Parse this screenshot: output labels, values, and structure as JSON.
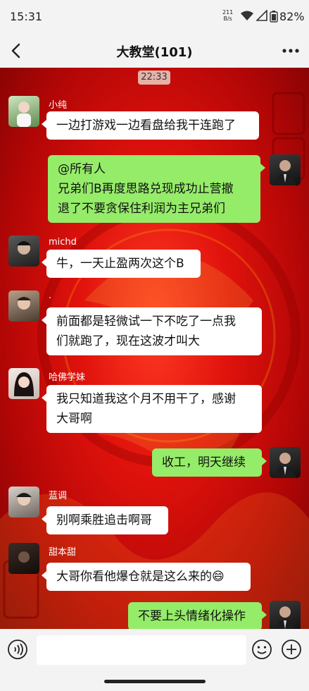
{
  "status": {
    "time": "15:31",
    "net_top": "211",
    "net_bottom": "B/s",
    "battery": "82%"
  },
  "header": {
    "title": "大教堂(101)"
  },
  "chat": {
    "timestamp": "22:33",
    "messages": [
      {
        "sender": "小纯",
        "text": "一边打游戏一边看盘给我干连跑了"
      },
      {
        "sender": "",
        "text": "@所有人\n兄弟们B再度思路兑现成功止营撤\n退了不要贪保住利润为主兄弟们"
      },
      {
        "sender": "michd",
        "text": "牛，一天止盈两次这个B"
      },
      {
        "sender": ".",
        "text": "前面都是轻微试一下不吃了一点我\n们就跑了，现在这波才叫大"
      },
      {
        "sender": "哈佛学妹",
        "text": "我只知道我这个月不用干了，感谢\n大哥啊"
      },
      {
        "sender": "",
        "text": "收工，明天继续"
      },
      {
        "sender": "蓝调",
        "text": "别啊乘胜追击啊哥"
      },
      {
        "sender": "甜本甜",
        "text": "大哥你看他爆仓就是这么来的😄"
      },
      {
        "sender": "",
        "text": "不要上头情绪化操作"
      }
    ]
  },
  "colors": {
    "outgoing_bubble": "#95ec69",
    "incoming_bubble": "#ffffff",
    "background": "#c80a06"
  }
}
